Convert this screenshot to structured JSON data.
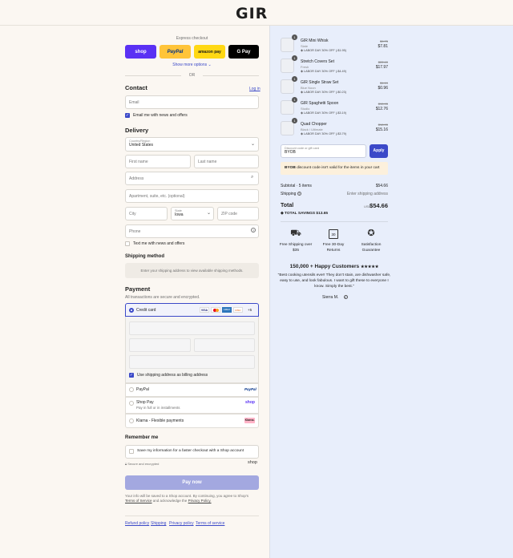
{
  "brand": {
    "logo": "GIR"
  },
  "express": {
    "label": "Express checkout",
    "buttons": [
      {
        "label": "shop",
        "bg": "#5a31f4",
        "fg": "#ffffff"
      },
      {
        "label": "PayPal",
        "bg": "#ffc439",
        "fg": "#003087"
      },
      {
        "label": "amazon pay",
        "bg": "#ffd814",
        "fg": "#1a1a1a"
      },
      {
        "label": "G Pay",
        "bg": "#000000",
        "fg": "#ffffff"
      }
    ],
    "more": "Show more options",
    "or": "OR"
  },
  "contact": {
    "title": "Contact",
    "login": "Log in",
    "email_placeholder": "Email",
    "news_label": "Email me with news and offers"
  },
  "delivery": {
    "title": "Delivery",
    "country_label": "Country/Region",
    "country_value": "United States",
    "first_name": "First name",
    "last_name": "Last name",
    "address": "Address",
    "apartment": "Apartment, suite, etc. (optional)",
    "city": "City",
    "state_label": "State",
    "state_value": "Iowa",
    "zip": "ZIP code",
    "phone": "Phone",
    "text_label": "Text me with news and offers"
  },
  "shipping": {
    "title": "Shipping method",
    "note": "Enter your shipping address to view available shipping methods."
  },
  "payment": {
    "title": "Payment",
    "subtitle": "All transactions are secure and encrypted.",
    "credit_card": "Credit card",
    "card_logos": [
      "VISA",
      "MC",
      "AMEX",
      "DISC"
    ],
    "more_cards": "+5",
    "billing_label": "Use shipping address as billing address",
    "paypal": "PayPal",
    "paypal_logo": "PayPal",
    "shoppay": "Shop Pay",
    "shoppay_sub": "Pay in full or in installments",
    "shoppay_logo": "shop",
    "klarna": "Klarna - Flexible payments",
    "klarna_logo": "Klarna."
  },
  "remember": {
    "title": "Remember me",
    "save_label": "Save my information for a faster checkout with a Shop account",
    "secure": "Secure and encrypted",
    "shop": "shop"
  },
  "pay_button": "Pay now",
  "terms": {
    "line1": "Your info will be saved to a Shop account. By continuing, you agree to Shop's",
    "tos": "Terms of Service",
    "and": "and acknowledge the",
    "privacy": "Privacy Policy."
  },
  "footer_links": [
    "Refund policy",
    "Shipping",
    "Privacy policy",
    "Terms of service"
  ],
  "cart": {
    "items": [
      {
        "qty": "1",
        "name": "GIR Mini Whisk",
        "variant": "Slate",
        "discount": "LABOR DAY 30% OFF (-$1.95)",
        "old": "$9.75",
        "price": "$7.81"
      },
      {
        "qty": "1",
        "name": "Stretch Covers Set",
        "variant": "Fresh",
        "discount": "LABOR DAY 30% OFF (-$4.49)",
        "old": "$22.49",
        "price": "$17.97"
      },
      {
        "qty": "1",
        "name": "GIR Single Straw Set",
        "variant": "Blue Noon",
        "discount": "LABOR DAY 30% OFF (-$0.23)",
        "old": "$1.19",
        "price": "$0.96"
      },
      {
        "qty": "1",
        "name": "GIR Spaghetti Spoon",
        "variant": "Studio",
        "discount": "LABOR DAY 30% OFF (-$3.19)",
        "old": "$15.95",
        "price": "$12.76"
      },
      {
        "qty": "1",
        "name": "Quad Chopper",
        "variant": "Black / Ultimate",
        "discount": "LABOR DAY 30% OFF (-$3.79)",
        "old": "$18.95",
        "price": "$15.16"
      }
    ],
    "discount_label": "Discount code or gift card",
    "discount_value": "BYOB",
    "apply": "Apply",
    "warning_code": "BYOB",
    "warning_text": "discount code isn't valid for the items in your cart",
    "subtotal_label": "Subtotal · 5 items",
    "subtotal_value": "$54.66",
    "shipping_label": "Shipping",
    "shipping_value": "Enter shipping address",
    "total_label": "Total",
    "currency": "USD",
    "total_value": "$54.66",
    "savings_label": "TOTAL SAVINGS",
    "savings_value": "$13.65"
  },
  "perks": [
    {
      "line1": "Free Shipping over",
      "line2": "$35"
    },
    {
      "line1": "Free 30-Day",
      "line2": "Returns"
    },
    {
      "line1": "Satisfaction",
      "line2": "Guarantee"
    }
  ],
  "testimonial": {
    "heading": "150,000 + Happy Customers",
    "stars": "★★★★★",
    "quote": "\"Best cooking utensils ever! They don't stain, are dishwasher safe, easy to use, and look fabulous. I want to gift these to everyone I know. Simply the best.\"",
    "author": "Sierra M."
  }
}
